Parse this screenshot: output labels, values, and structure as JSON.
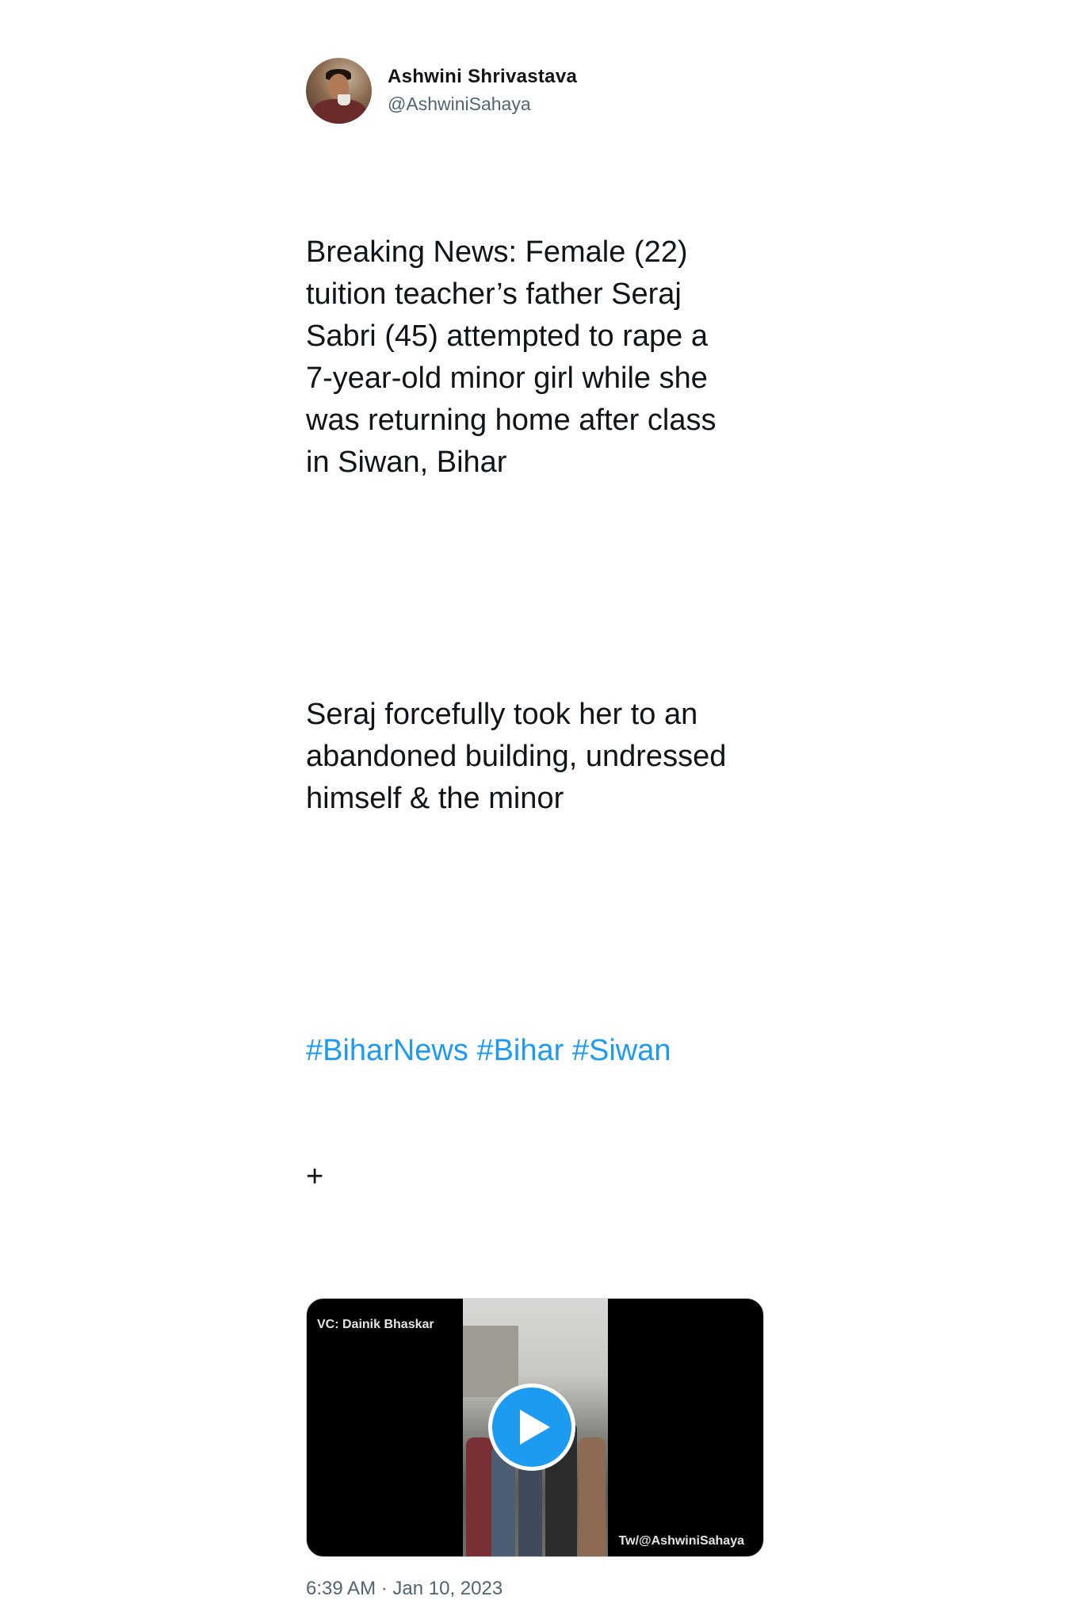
{
  "author": {
    "display_name": "Ashwini Shrivastava",
    "handle": "@AshwiniSahaya"
  },
  "tweet": {
    "paragraph1": "Breaking News: Female (22)\ntuition teacher’s father Seraj\nSabri (45) attempted to rape a\n7-year-old minor girl while she\nwas returning home after class\nin Siwan, Bihar",
    "paragraph2": "Seraj forcefully took her to an\nabandoned building, undressed\nhimself & the minor",
    "hashtags": [
      "#BiharNews",
      "#Bihar",
      "#Siwan"
    ],
    "extra_line": "+",
    "timestamp": "6:39 AM · Jan 10, 2023"
  },
  "media": {
    "watermark_left": "VC: Dainik Bhaskar",
    "watermark_right": "Tw/@AshwiniSahaya",
    "play_icon": "play-icon"
  },
  "colors": {
    "link": "#1d9bf0",
    "secondary_text": "#536471",
    "primary_text": "#0f1419"
  }
}
